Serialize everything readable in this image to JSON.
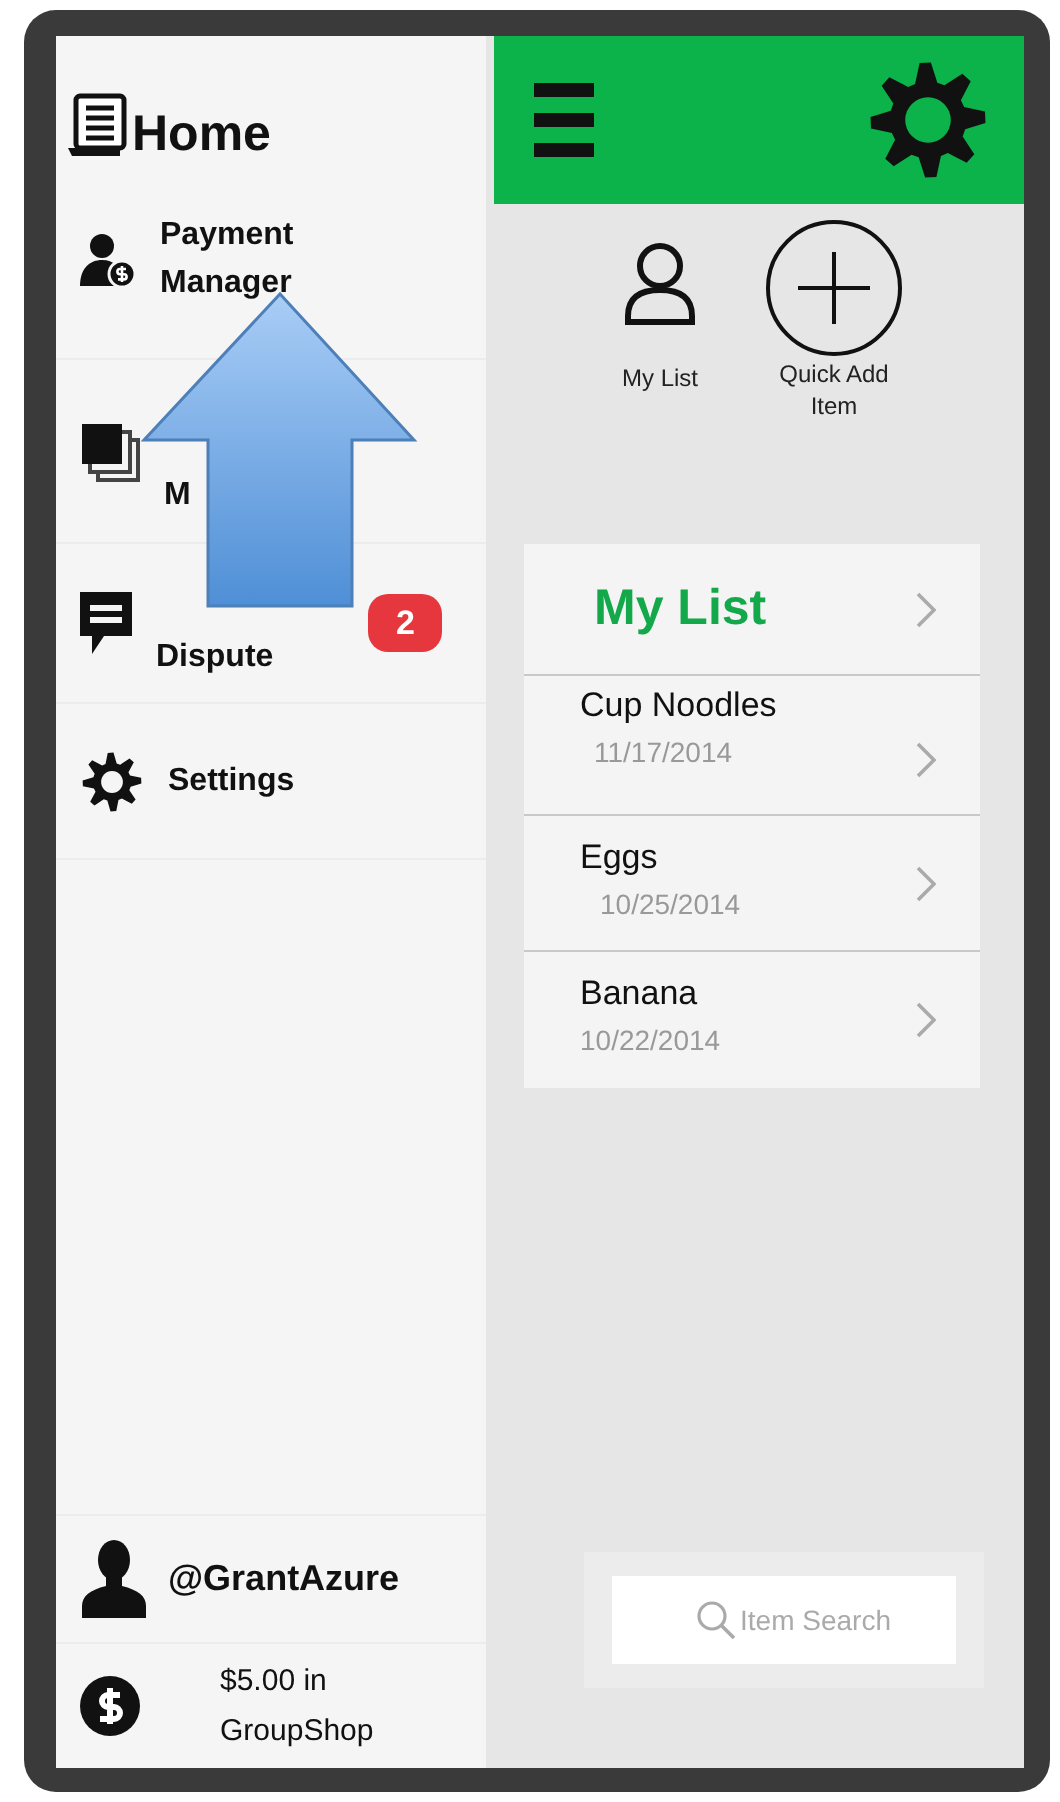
{
  "sidebar": {
    "title": "Home",
    "items": [
      {
        "label": "Payment Manager"
      },
      {
        "label": "M"
      },
      {
        "label": "Dispute",
        "badge": "2"
      },
      {
        "label": "Settings"
      }
    ],
    "user": "@GrantAzure",
    "balance": "$5.00 in GroupShop"
  },
  "actions": [
    {
      "label": "My List"
    },
    {
      "label": "Quick Add Item"
    }
  ],
  "list": {
    "title": "My List",
    "items": [
      {
        "name": "Cup Noodles",
        "date": "11/17/2014"
      },
      {
        "name": "Eggs",
        "date": "10/25/2014"
      },
      {
        "name": "Banana",
        "date": "10/22/2014"
      }
    ]
  },
  "search": {
    "placeholder": "Item Search"
  }
}
